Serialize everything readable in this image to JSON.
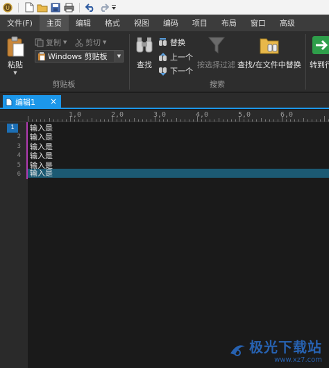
{
  "quick_access": {
    "icons": [
      "app-logo-icon",
      "new-file-icon",
      "open-folder-icon",
      "save-icon",
      "print-icon",
      "undo-icon",
      "redo-icon",
      "customize-dropdown-icon"
    ]
  },
  "menu_tabs": [
    "文件(F)",
    "主页",
    "编辑",
    "格式",
    "视图",
    "编码",
    "项目",
    "布局",
    "窗口",
    "高级"
  ],
  "active_tab": "主页",
  "ribbon": {
    "clipboard": {
      "paste_label": "粘贴",
      "copy_label": "复制",
      "cut_label": "剪切",
      "clipboard_combo_value": "Windows 剪贴板",
      "group_label": "剪贴板"
    },
    "search": {
      "find_label": "查找",
      "replace_label": "替换",
      "prev_label": "上一个",
      "next_label": "下一个",
      "filter_label": "按选择过滤",
      "find_in_files_label": "查找/在文件中替换",
      "group_label": "搜索"
    },
    "goto_label": "转到行"
  },
  "document_tab": {
    "title": "编辑1",
    "close_glyph": "×"
  },
  "ruler": {
    "labels": [
      "1,0",
      "2,0",
      "3,0",
      "4,0",
      "5,0",
      "6,0"
    ]
  },
  "editor": {
    "line_numbers": [
      "1",
      "2",
      "3",
      "4",
      "5",
      "6"
    ],
    "current_line": "1",
    "lines": [
      "输入是",
      "输入是",
      "输入是",
      "输入是",
      "输入是",
      "输入是"
    ]
  },
  "watermark": {
    "title": "极光下载站",
    "url": "www.xz7.com"
  },
  "colors": {
    "accent": "#1c97ea",
    "highlight_line": "#1c5a73",
    "modified_bar": "#b23bb2"
  }
}
